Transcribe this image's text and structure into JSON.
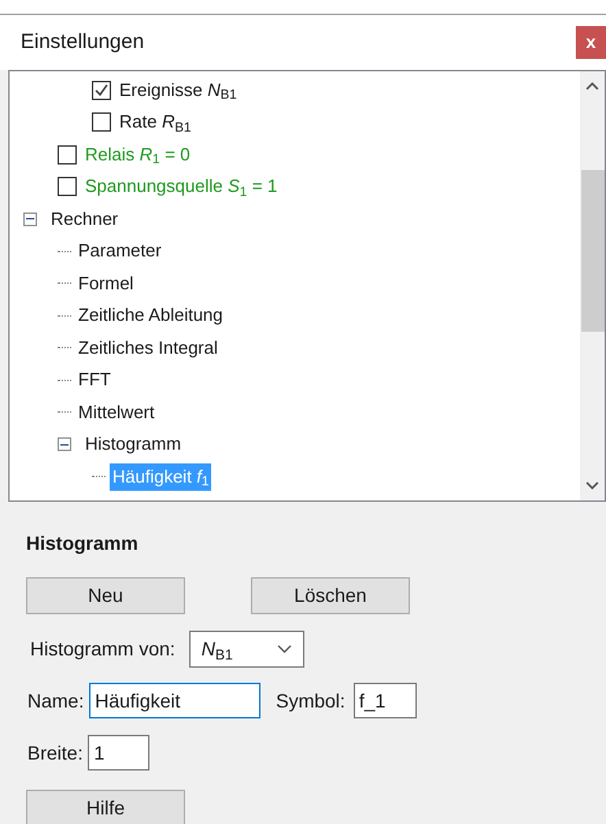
{
  "panel": {
    "title": "Einstellungen",
    "close": "x"
  },
  "tree": [
    {
      "children": [
        {
          "children": [
            {
              "label": "Ereignisse *N*$_{B1}$",
              "kind": "checkbox",
              "checked": true,
              "selected": false
            },
            {
              "label": "Rate *R*$_{B1}$",
              "kind": "checkbox",
              "checked": false,
              "selected": false
            }
          ]
        },
        {
          "label": "Relais *R*$_{1}$ = 0",
          "kind": "checkbox",
          "checked": false,
          "selected": false,
          "color": "#1e9a1e"
        },
        {
          "label": "Spannungsquelle *S*$_{1}$ = 1",
          "kind": "checkbox",
          "checked": false,
          "selected": false,
          "color": "#1e9a1e"
        }
      ]
    },
    {
      "label": "Rechner",
      "kind": "folder",
      "expanded": true,
      "selected": false,
      "children": [
        {
          "label": "Parameter",
          "kind": "leaf",
          "selected": false
        },
        {
          "label": "Formel",
          "kind": "leaf",
          "selected": false
        },
        {
          "label": "Zeitliche Ableitung",
          "kind": "leaf",
          "selected": false
        },
        {
          "label": "Zeitliches Integral",
          "kind": "leaf",
          "selected": false
        },
        {
          "label": "FFT",
          "kind": "leaf",
          "selected": false
        },
        {
          "label": "Mittelwert",
          "kind": "leaf",
          "selected": false
        },
        {
          "label": "Histogramm",
          "kind": "folder",
          "expanded": true,
          "selected": false,
          "children": [
            {
              "label": "Häufigkeit *f*$_{1}$",
              "kind": "leaf",
              "selected": true
            }
          ]
        }
      ]
    }
  ],
  "section": {
    "heading": "Histogramm",
    "buttons": [
      "Neu",
      "Löschen"
    ],
    "source": {
      "label": "Histogramm von:",
      "value": "*N*$_{B1}$"
    },
    "name": {
      "label": "Name:",
      "value": "Häufigkeit"
    },
    "symbol": {
      "label": "Symbol:",
      "value": "f_1"
    },
    "width": {
      "label": "Breite:",
      "value": "1"
    },
    "help": "Hilfe"
  }
}
